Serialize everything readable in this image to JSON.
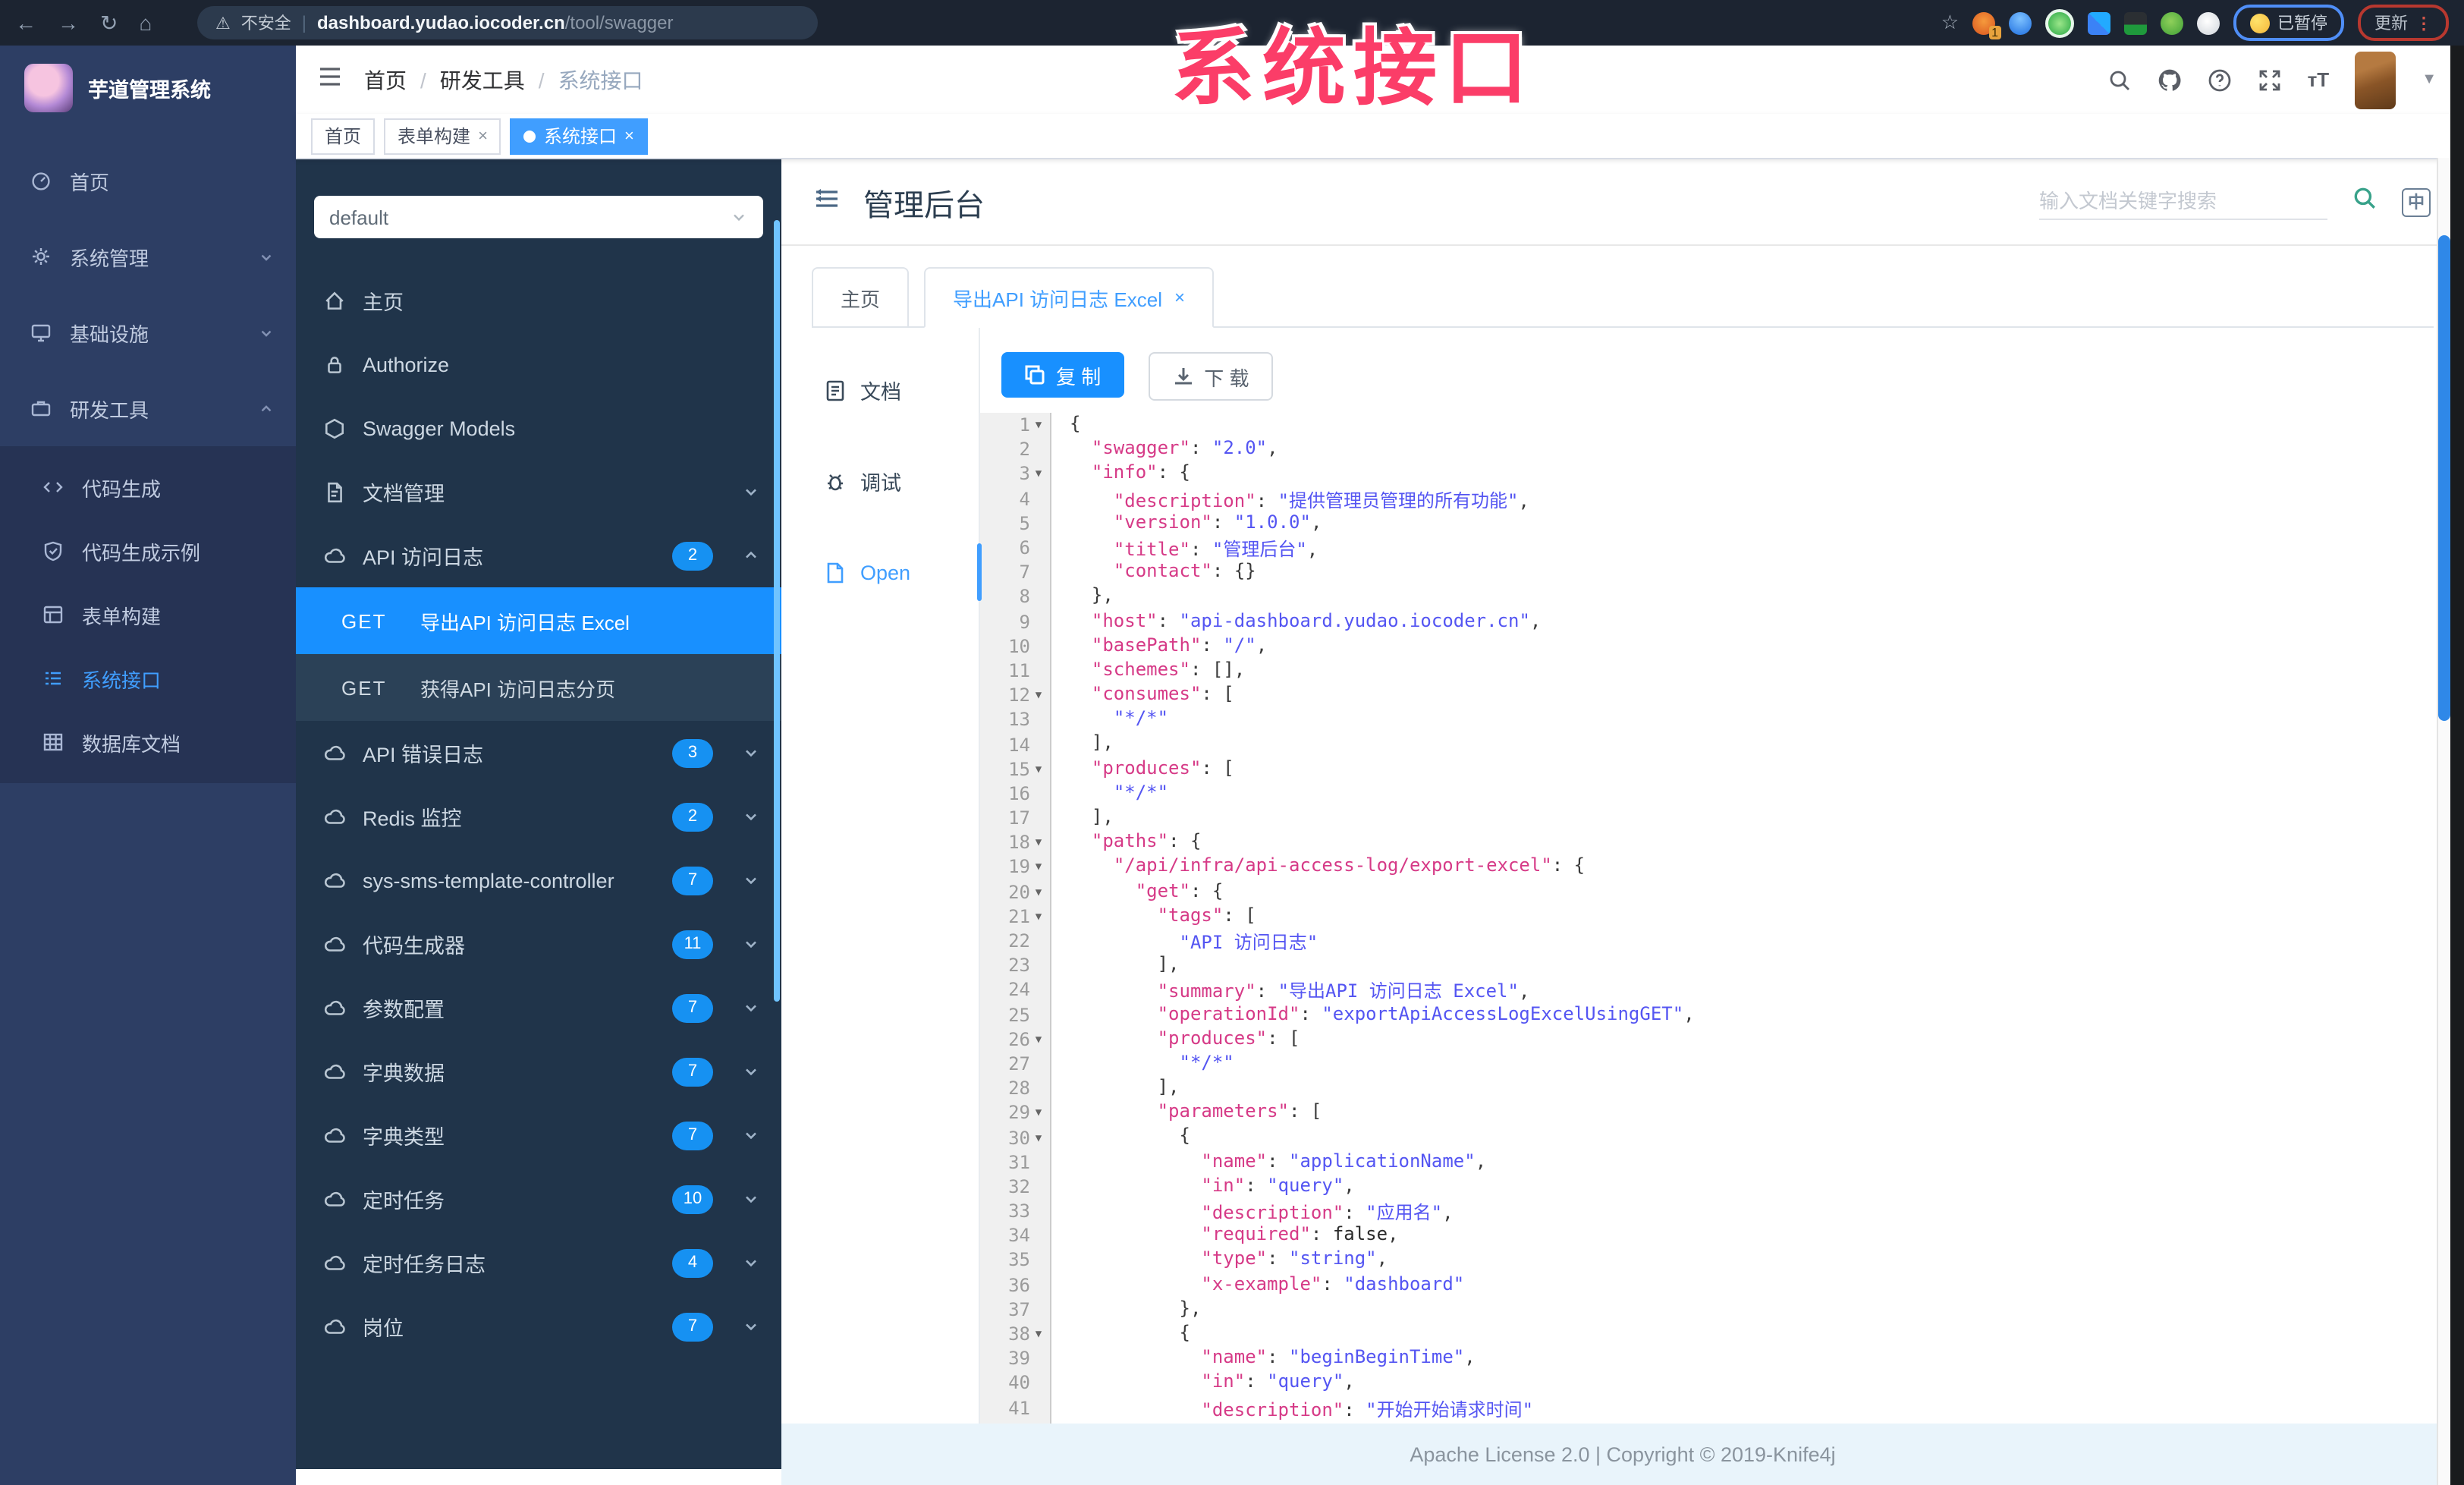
{
  "browser": {
    "security_label": "不安全",
    "url_domain": "dashboard.yudao.iocoder.cn",
    "url_path": "/tool/swagger",
    "ext_badge": "1",
    "paused_label": "已暂停",
    "update_label": "更新",
    "menu_dots": "⋮"
  },
  "annotation": {
    "text": "系统接口",
    "color": "#fb3d68"
  },
  "app_sidebar": {
    "title": "芋道管理系统",
    "items": [
      {
        "label": "首页"
      },
      {
        "label": "系统管理"
      },
      {
        "label": "基础设施"
      },
      {
        "label": "研发工具",
        "children": [
          {
            "label": "代码生成"
          },
          {
            "label": "代码生成示例"
          },
          {
            "label": "表单构建"
          },
          {
            "label": "系统接口",
            "active": true
          },
          {
            "label": "数据库文档"
          }
        ]
      }
    ]
  },
  "header": {
    "breadcrumb": [
      "首页",
      "研发工具",
      "系统接口"
    ]
  },
  "tags": [
    {
      "label": "首页",
      "closable": false,
      "active": false
    },
    {
      "label": "表单构建",
      "closable": true,
      "active": false
    },
    {
      "label": "系统接口",
      "closable": true,
      "active": true
    }
  ],
  "swagger_sidebar": {
    "group_select": "default",
    "items": [
      {
        "type": "home",
        "label": "主页"
      },
      {
        "type": "lock",
        "label": "Authorize"
      },
      {
        "type": "models",
        "label": "Swagger Models"
      },
      {
        "type": "doc",
        "label": "文档管理",
        "chevron": "down"
      },
      {
        "type": "cloud",
        "label": "API 访问日志",
        "badge": "2",
        "chevron": "up",
        "children": [
          {
            "method": "GET",
            "label": "导出API 访问日志 Excel",
            "active": true
          },
          {
            "method": "GET",
            "label": "获得API 访问日志分页",
            "active": false
          }
        ]
      },
      {
        "type": "cloud",
        "label": "API 错误日志",
        "badge": "3",
        "chevron": "down"
      },
      {
        "type": "cloud",
        "label": "Redis 监控",
        "badge": "2",
        "chevron": "down"
      },
      {
        "type": "cloud",
        "label": "sys-sms-template-controller",
        "badge": "7",
        "chevron": "down"
      },
      {
        "type": "cloud",
        "label": "代码生成器",
        "badge": "11",
        "chevron": "down"
      },
      {
        "type": "cloud",
        "label": "参数配置",
        "badge": "7",
        "chevron": "down"
      },
      {
        "type": "cloud",
        "label": "字典数据",
        "badge": "7",
        "chevron": "down"
      },
      {
        "type": "cloud",
        "label": "字典类型",
        "badge": "7",
        "chevron": "down"
      },
      {
        "type": "cloud",
        "label": "定时任务",
        "badge": "10",
        "chevron": "down"
      },
      {
        "type": "cloud",
        "label": "定时任务日志",
        "badge": "4",
        "chevron": "down"
      },
      {
        "type": "cloud",
        "label": "岗位",
        "badge": "7",
        "chevron": "down"
      }
    ]
  },
  "doc": {
    "title": "管理后台",
    "search_placeholder": "输入文档关键字搜索",
    "lang_icon": "中",
    "tabs": [
      {
        "label": "主页",
        "closable": false,
        "active": false
      },
      {
        "label": "导出API 访问日志 Excel",
        "closable": true,
        "active": true
      }
    ],
    "side_tabs": [
      {
        "label": "文档",
        "icon": "doc-text",
        "active": false
      },
      {
        "label": "调试",
        "icon": "debug",
        "active": false
      },
      {
        "label": "Open",
        "icon": "file-open",
        "active": true
      }
    ],
    "copy_label": "复 制",
    "download_label": "下 载"
  },
  "code": {
    "lines": [
      {
        "n": 1,
        "f": true,
        "t": [
          [
            "{",
            "p"
          ]
        ]
      },
      {
        "n": 2,
        "f": false,
        "t": [
          [
            "  ",
            "p"
          ],
          [
            "\"swagger\"",
            "k"
          ],
          [
            ": ",
            "p"
          ],
          [
            "\"2.0\"",
            "s"
          ],
          [
            ",",
            "p"
          ]
        ]
      },
      {
        "n": 3,
        "f": true,
        "t": [
          [
            "  ",
            "p"
          ],
          [
            "\"info\"",
            "k"
          ],
          [
            ": {",
            "p"
          ]
        ]
      },
      {
        "n": 4,
        "f": false,
        "t": [
          [
            "    ",
            "p"
          ],
          [
            "\"description\"",
            "k"
          ],
          [
            ": ",
            "p"
          ],
          [
            "\"提供管理员管理的所有功能\"",
            "s"
          ],
          [
            ",",
            "p"
          ]
        ]
      },
      {
        "n": 5,
        "f": false,
        "t": [
          [
            "    ",
            "p"
          ],
          [
            "\"version\"",
            "k"
          ],
          [
            ": ",
            "p"
          ],
          [
            "\"1.0.0\"",
            "s"
          ],
          [
            ",",
            "p"
          ]
        ]
      },
      {
        "n": 6,
        "f": false,
        "t": [
          [
            "    ",
            "p"
          ],
          [
            "\"title\"",
            "k"
          ],
          [
            ": ",
            "p"
          ],
          [
            "\"管理后台\"",
            "s"
          ],
          [
            ",",
            "p"
          ]
        ]
      },
      {
        "n": 7,
        "f": false,
        "t": [
          [
            "    ",
            "p"
          ],
          [
            "\"contact\"",
            "k"
          ],
          [
            ": {}",
            "p"
          ]
        ]
      },
      {
        "n": 8,
        "f": false,
        "t": [
          [
            "  },",
            "p"
          ]
        ]
      },
      {
        "n": 9,
        "f": false,
        "t": [
          [
            "  ",
            "p"
          ],
          [
            "\"host\"",
            "k"
          ],
          [
            ": ",
            "p"
          ],
          [
            "\"api-dashboard.yudao.iocoder.cn\"",
            "s"
          ],
          [
            ",",
            "p"
          ]
        ]
      },
      {
        "n": 10,
        "f": false,
        "t": [
          [
            "  ",
            "p"
          ],
          [
            "\"basePath\"",
            "k"
          ],
          [
            ": ",
            "p"
          ],
          [
            "\"/\"",
            "s"
          ],
          [
            ",",
            "p"
          ]
        ]
      },
      {
        "n": 11,
        "f": false,
        "t": [
          [
            "  ",
            "p"
          ],
          [
            "\"schemes\"",
            "k"
          ],
          [
            ": [],",
            "p"
          ]
        ]
      },
      {
        "n": 12,
        "f": true,
        "t": [
          [
            "  ",
            "p"
          ],
          [
            "\"consumes\"",
            "k"
          ],
          [
            ": [",
            "p"
          ]
        ]
      },
      {
        "n": 13,
        "f": false,
        "t": [
          [
            "    ",
            "p"
          ],
          [
            "\"*/*\"",
            "s"
          ]
        ]
      },
      {
        "n": 14,
        "f": false,
        "t": [
          [
            "  ],",
            "p"
          ]
        ]
      },
      {
        "n": 15,
        "f": true,
        "t": [
          [
            "  ",
            "p"
          ],
          [
            "\"produces\"",
            "k"
          ],
          [
            ": [",
            "p"
          ]
        ]
      },
      {
        "n": 16,
        "f": false,
        "t": [
          [
            "    ",
            "p"
          ],
          [
            "\"*/*\"",
            "s"
          ]
        ]
      },
      {
        "n": 17,
        "f": false,
        "t": [
          [
            "  ],",
            "p"
          ]
        ]
      },
      {
        "n": 18,
        "f": true,
        "t": [
          [
            "  ",
            "p"
          ],
          [
            "\"paths\"",
            "k"
          ],
          [
            ": {",
            "p"
          ]
        ]
      },
      {
        "n": 19,
        "f": true,
        "t": [
          [
            "    ",
            "p"
          ],
          [
            "\"/api/infra/api-access-log/export-excel\"",
            "k"
          ],
          [
            ": {",
            "p"
          ]
        ]
      },
      {
        "n": 20,
        "f": true,
        "t": [
          [
            "      ",
            "p"
          ],
          [
            "\"get\"",
            "k"
          ],
          [
            ": {",
            "p"
          ]
        ]
      },
      {
        "n": 21,
        "f": true,
        "t": [
          [
            "        ",
            "p"
          ],
          [
            "\"tags\"",
            "k"
          ],
          [
            ": [",
            "p"
          ]
        ]
      },
      {
        "n": 22,
        "f": false,
        "t": [
          [
            "          ",
            "p"
          ],
          [
            "\"API 访问日志\"",
            "s"
          ]
        ]
      },
      {
        "n": 23,
        "f": false,
        "t": [
          [
            "        ],",
            "p"
          ]
        ]
      },
      {
        "n": 24,
        "f": false,
        "t": [
          [
            "        ",
            "p"
          ],
          [
            "\"summary\"",
            "k"
          ],
          [
            ": ",
            "p"
          ],
          [
            "\"导出API 访问日志 Excel\"",
            "s"
          ],
          [
            ",",
            "p"
          ]
        ]
      },
      {
        "n": 25,
        "f": false,
        "t": [
          [
            "        ",
            "p"
          ],
          [
            "\"operationId\"",
            "k"
          ],
          [
            ": ",
            "p"
          ],
          [
            "\"exportApiAccessLogExcelUsingGET\"",
            "s"
          ],
          [
            ",",
            "p"
          ]
        ]
      },
      {
        "n": 26,
        "f": true,
        "t": [
          [
            "        ",
            "p"
          ],
          [
            "\"produces\"",
            "k"
          ],
          [
            ": [",
            "p"
          ]
        ]
      },
      {
        "n": 27,
        "f": false,
        "t": [
          [
            "          ",
            "p"
          ],
          [
            "\"*/*\"",
            "s"
          ]
        ]
      },
      {
        "n": 28,
        "f": false,
        "t": [
          [
            "        ],",
            "p"
          ]
        ]
      },
      {
        "n": 29,
        "f": true,
        "t": [
          [
            "        ",
            "p"
          ],
          [
            "\"parameters\"",
            "k"
          ],
          [
            ": [",
            "p"
          ]
        ]
      },
      {
        "n": 30,
        "f": true,
        "t": [
          [
            "          {",
            "p"
          ]
        ]
      },
      {
        "n": 31,
        "f": false,
        "t": [
          [
            "            ",
            "p"
          ],
          [
            "\"name\"",
            "k"
          ],
          [
            ": ",
            "p"
          ],
          [
            "\"applicationName\"",
            "s"
          ],
          [
            ",",
            "p"
          ]
        ]
      },
      {
        "n": 32,
        "f": false,
        "t": [
          [
            "            ",
            "p"
          ],
          [
            "\"in\"",
            "k"
          ],
          [
            ": ",
            "p"
          ],
          [
            "\"query\"",
            "s"
          ],
          [
            ",",
            "p"
          ]
        ]
      },
      {
        "n": 33,
        "f": false,
        "t": [
          [
            "            ",
            "p"
          ],
          [
            "\"description\"",
            "k"
          ],
          [
            ": ",
            "p"
          ],
          [
            "\"应用名\"",
            "s"
          ],
          [
            ",",
            "p"
          ]
        ]
      },
      {
        "n": 34,
        "f": false,
        "t": [
          [
            "            ",
            "p"
          ],
          [
            "\"required\"",
            "k"
          ],
          [
            ": ",
            "p"
          ],
          [
            "false",
            "b"
          ],
          [
            ",",
            "p"
          ]
        ]
      },
      {
        "n": 35,
        "f": false,
        "t": [
          [
            "            ",
            "p"
          ],
          [
            "\"type\"",
            "k"
          ],
          [
            ": ",
            "p"
          ],
          [
            "\"string\"",
            "s"
          ],
          [
            ",",
            "p"
          ]
        ]
      },
      {
        "n": 36,
        "f": false,
        "t": [
          [
            "            ",
            "p"
          ],
          [
            "\"x-example\"",
            "k"
          ],
          [
            ": ",
            "p"
          ],
          [
            "\"dashboard\"",
            "s"
          ]
        ]
      },
      {
        "n": 37,
        "f": false,
        "t": [
          [
            "          },",
            "p"
          ]
        ]
      },
      {
        "n": 38,
        "f": true,
        "t": [
          [
            "          {",
            "p"
          ]
        ]
      },
      {
        "n": 39,
        "f": false,
        "t": [
          [
            "            ",
            "p"
          ],
          [
            "\"name\"",
            "k"
          ],
          [
            ": ",
            "p"
          ],
          [
            "\"beginBeginTime\"",
            "s"
          ],
          [
            ",",
            "p"
          ]
        ]
      },
      {
        "n": 40,
        "f": false,
        "t": [
          [
            "            ",
            "p"
          ],
          [
            "\"in\"",
            "k"
          ],
          [
            ": ",
            "p"
          ],
          [
            "\"query\"",
            "s"
          ],
          [
            ",",
            "p"
          ]
        ]
      },
      {
        "n": 41,
        "f": false,
        "t": [
          [
            "            ",
            "p"
          ],
          [
            "\"description\"",
            "k"
          ],
          [
            ": ",
            "p"
          ],
          [
            "\"开始开始请求时间\"",
            "s"
          ]
        ]
      }
    ]
  },
  "footer": {
    "text": "Apache License 2.0 | Copyright © 2019-Knife4j"
  },
  "colors": {
    "accent_blue": "#409eff",
    "primary_blue": "#1890ff",
    "sidebar_bg": "#2d3e64",
    "swagger_bg": "#20344a",
    "annotation_pink": "#fb3d68",
    "code_key": "#d63a87",
    "code_string": "#5455f2",
    "footer_bg": "#e9f4fb"
  }
}
